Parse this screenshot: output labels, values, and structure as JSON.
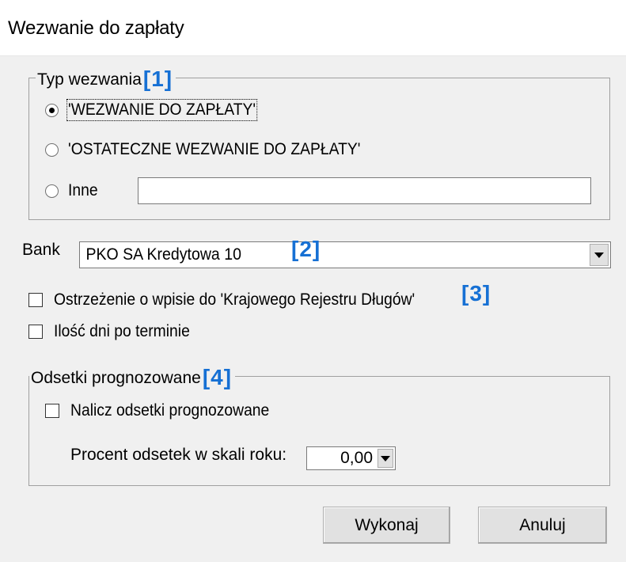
{
  "window": {
    "title": "Wezwanie do zapłaty"
  },
  "typ_wezwania": {
    "legend": "Typ wezwania",
    "annotation": "[1]",
    "options": [
      {
        "label": "'WEZWANIE DO ZAPŁATY'",
        "checked": true
      },
      {
        "label": "'OSTATECZNE WEZWANIE DO ZAPŁATY'",
        "checked": false
      },
      {
        "label": "Inne",
        "checked": false
      }
    ],
    "inne_value": ""
  },
  "bank": {
    "label": "Bank",
    "selected": "PKO SA Kredytowa 10",
    "annotation": "[2]"
  },
  "ostrzezenie": {
    "label": "Ostrzeżenie o wpisie do 'Krajowego Rejestru Długów'",
    "checked": false,
    "annotation": "[3]"
  },
  "ilosc_dni": {
    "label": "Ilość dni po terminie",
    "checked": false
  },
  "odsetki": {
    "legend": "Odsetki prognozowane",
    "annotation": "[4]",
    "nalicz_label": "Nalicz odsetki prognozowane",
    "nalicz_checked": false,
    "procent_label": "Procent odsetek w skali roku:",
    "procent_value": "0,00"
  },
  "buttons": {
    "execute_label": "Wykonaj",
    "cancel_label": "Anuluj"
  },
  "colors": {
    "annotation": "#1670d4",
    "dialog_background": "#f0f0f0",
    "button_face": "#e1e1e1"
  }
}
